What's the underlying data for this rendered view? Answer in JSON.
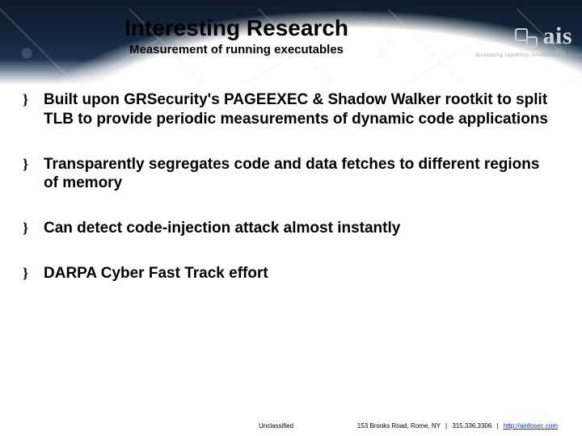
{
  "header": {
    "title": "Interesting Research",
    "subtitle": "Measurement of running executables"
  },
  "logo": {
    "text": "ais",
    "tagline": "devastating capability. revolutionary advantage"
  },
  "bullets": [
    "Built upon GRSecurity's PAGEEXEC & Shadow Walker rootkit to split TLB to provide periodic measurements of dynamic code applications",
    "Transparently segregates code and data fetches to different regions of memory",
    "Can detect code-injection attack almost instantly",
    "DARPA Cyber Fast Track effort"
  ],
  "footer": {
    "classification": "Unclassified",
    "address": "153 Brooks Road, Rome, NY",
    "phone": "315.336.3306",
    "url_label": "http://ainfosec.com",
    "url_href": "http://ainfosec.com"
  }
}
